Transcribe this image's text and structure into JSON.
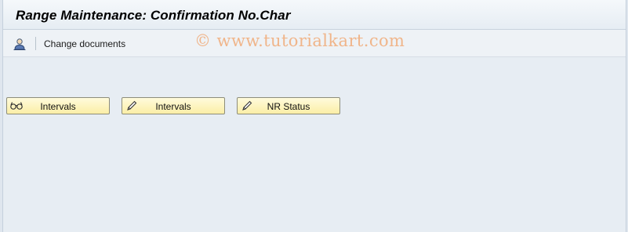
{
  "window": {
    "title": "Range Maintenance: Confirmation No.Char"
  },
  "toolbar": {
    "change_docs_label": "Change documents",
    "change_docs_icon": "user-document-icon"
  },
  "watermark": {
    "text": "© www.tutorialkart.com"
  },
  "buttons": [
    {
      "label": "Intervals",
      "icon": "glasses-icon"
    },
    {
      "label": "Intervals",
      "icon": "pencil-icon"
    },
    {
      "label": "NR Status",
      "icon": "pencil-icon"
    }
  ],
  "colors": {
    "button_fill": "#fbeea6",
    "background": "#e7edf3",
    "watermark": "#f0b58a"
  }
}
